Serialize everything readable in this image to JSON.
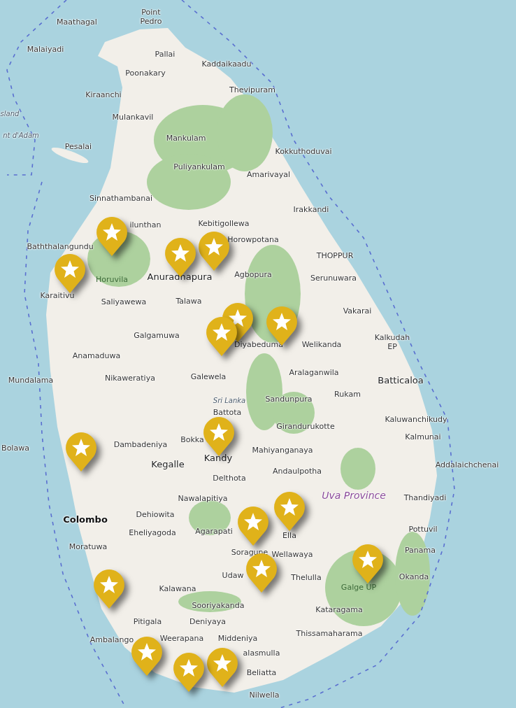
{
  "map": {
    "labels": [
      {
        "text": "Maathagal",
        "kind": "town"
      },
      {
        "text": "Point Pedro",
        "kind": "town"
      },
      {
        "text": "Malaiyadi",
        "kind": "town"
      },
      {
        "text": "Pallai",
        "kind": "town"
      },
      {
        "text": "Kaddaikaadu",
        "kind": "town"
      },
      {
        "text": "Poonakary",
        "kind": "town"
      },
      {
        "text": "Kiraanchi",
        "kind": "town"
      },
      {
        "text": "Thevipuram",
        "kind": "town"
      },
      {
        "text": "sland",
        "kind": "water"
      },
      {
        "text": "Mulankavil",
        "kind": "town"
      },
      {
        "text": "nt d'Adam",
        "kind": "water"
      },
      {
        "text": "Mankulam",
        "kind": "town"
      },
      {
        "text": "Pesalai",
        "kind": "town"
      },
      {
        "text": "Kokkuthoduvai",
        "kind": "town"
      },
      {
        "text": "Puliyankulam",
        "kind": "town"
      },
      {
        "text": "Amarivayal",
        "kind": "town"
      },
      {
        "text": "Sinnathambanai",
        "kind": "town"
      },
      {
        "text": "Irakkandi",
        "kind": "town"
      },
      {
        "text": "ilunthan",
        "kind": "town"
      },
      {
        "text": "Kebitigollewa",
        "kind": "town"
      },
      {
        "text": "Baththalangundu",
        "kind": "town"
      },
      {
        "text": "Horowpotana",
        "kind": "town"
      },
      {
        "text": "THOPPUR",
        "kind": "town"
      },
      {
        "text": "Horuvila",
        "kind": "park"
      },
      {
        "text": "Anuradhapura",
        "kind": "city"
      },
      {
        "text": "Agbopura",
        "kind": "town"
      },
      {
        "text": "Serunuwara",
        "kind": "town"
      },
      {
        "text": "Karaitivu",
        "kind": "town"
      },
      {
        "text": "Saliyawewa",
        "kind": "town"
      },
      {
        "text": "Talawa",
        "kind": "town"
      },
      {
        "text": "Vakarai",
        "kind": "town"
      },
      {
        "text": "Galgamuwa",
        "kind": "town"
      },
      {
        "text": "Diyabeduma",
        "kind": "town"
      },
      {
        "text": "Welikanda",
        "kind": "town"
      },
      {
        "text": "Kalkudah EP",
        "kind": "town"
      },
      {
        "text": "Anamaduwa",
        "kind": "town"
      },
      {
        "text": "Mundalama",
        "kind": "town"
      },
      {
        "text": "Nikaweratiya",
        "kind": "town"
      },
      {
        "text": "Galewela",
        "kind": "town"
      },
      {
        "text": "Aralaganwila",
        "kind": "town"
      },
      {
        "text": "Batticaloa",
        "kind": "city"
      },
      {
        "text": "Sri Lanka",
        "kind": "water"
      },
      {
        "text": "Sandunpura",
        "kind": "town"
      },
      {
        "text": "Rukam",
        "kind": "town"
      },
      {
        "text": "Battota",
        "kind": "town"
      },
      {
        "text": "Kaluwanchikudy",
        "kind": "town"
      },
      {
        "text": "Girandurukotte",
        "kind": "town"
      },
      {
        "text": "Bolawa",
        "kind": "town"
      },
      {
        "text": "Dambadeniya",
        "kind": "town"
      },
      {
        "text": "Bokka",
        "kind": "town"
      },
      {
        "text": "Mahiyanganaya",
        "kind": "town"
      },
      {
        "text": "Kalmunai",
        "kind": "town"
      },
      {
        "text": "Kegalle",
        "kind": "city"
      },
      {
        "text": "Kandy",
        "kind": "city"
      },
      {
        "text": "Andaulpotha",
        "kind": "town"
      },
      {
        "text": "Addalaichchenai",
        "kind": "town"
      },
      {
        "text": "Delthota",
        "kind": "town"
      },
      {
        "text": "Nawalapitiya",
        "kind": "town"
      },
      {
        "text": "Uva Province",
        "kind": "region"
      },
      {
        "text": "Thandiyadi",
        "kind": "town"
      },
      {
        "text": "Colombo",
        "kind": "capital"
      },
      {
        "text": "Dehiowita",
        "kind": "town"
      },
      {
        "text": "Eheliyagoda",
        "kind": "town"
      },
      {
        "text": "Agarapati",
        "kind": "town"
      },
      {
        "text": "Ella",
        "kind": "town"
      },
      {
        "text": "Pottuvil",
        "kind": "town"
      },
      {
        "text": "Moratuwa",
        "kind": "town"
      },
      {
        "text": "Soragune",
        "kind": "town"
      },
      {
        "text": "Wellawaya",
        "kind": "town"
      },
      {
        "text": "Panama",
        "kind": "town"
      },
      {
        "text": "Kalawana",
        "kind": "town"
      },
      {
        "text": "Udaw",
        "kind": "town"
      },
      {
        "text": "Thelulla",
        "kind": "town"
      },
      {
        "text": "Galge UP",
        "kind": "park"
      },
      {
        "text": "Okanda",
        "kind": "town"
      },
      {
        "text": "Sooriyakanda",
        "kind": "town"
      },
      {
        "text": "Kataragama",
        "kind": "town"
      },
      {
        "text": "Pitigala",
        "kind": "town"
      },
      {
        "text": "Deniyaya",
        "kind": "town"
      },
      {
        "text": "Ambalango",
        "kind": "town"
      },
      {
        "text": "Weerapana",
        "kind": "town"
      },
      {
        "text": "Middeniya",
        "kind": "town"
      },
      {
        "text": "Thissamaharama",
        "kind": "town"
      },
      {
        "text": "alasmulla",
        "kind": "town"
      },
      {
        "text": "Beliatta",
        "kind": "town"
      },
      {
        "text": "Nilwella",
        "kind": "town"
      }
    ],
    "markers": [
      {
        "kind": "star"
      },
      {
        "kind": "star"
      },
      {
        "kind": "star"
      },
      {
        "kind": "star"
      },
      {
        "kind": "star"
      },
      {
        "kind": "star"
      },
      {
        "kind": "star"
      },
      {
        "kind": "star"
      },
      {
        "kind": "star"
      },
      {
        "kind": "star"
      },
      {
        "kind": "star"
      },
      {
        "kind": "star"
      },
      {
        "kind": "star"
      },
      {
        "kind": "star"
      },
      {
        "kind": "star"
      },
      {
        "kind": "star"
      },
      {
        "kind": "star"
      }
    ]
  }
}
